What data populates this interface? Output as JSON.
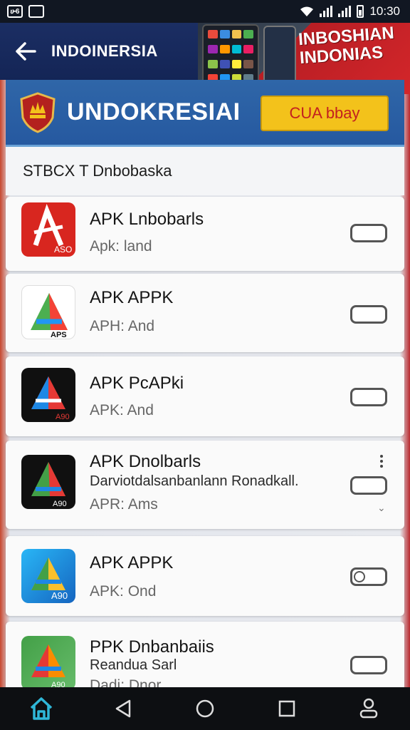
{
  "status_bar": {
    "time": "10:30",
    "left_icon_text": "ሁ6"
  },
  "header": {
    "title": "INDOINERSIA"
  },
  "banner": {
    "text": "INBOSHIAN INDONIAS"
  },
  "hero": {
    "title": "UNDOKRESIAI",
    "cta_label": "CUA bbay"
  },
  "section": {
    "title": "STBCX T Dnbobaska"
  },
  "apps": [
    {
      "name": "APK Lnbobarls",
      "desc": "",
      "meta": "Apk: land"
    },
    {
      "name": "APK APPK",
      "desc": "",
      "meta": "APH: And"
    },
    {
      "name": "APK PcAPki",
      "desc": "",
      "meta": "APK: And"
    },
    {
      "name": "APK Dnolbarls",
      "desc": "Darviotdalsanbanlann Ronadkall.",
      "meta": "APR: Ams"
    },
    {
      "name": "APK APPK",
      "desc": "",
      "meta": "APK: Ond"
    },
    {
      "name": "PPK Dnbanbaiis",
      "desc": "Reandua Sarl",
      "meta": "Dadi: Dnor"
    }
  ],
  "icon_badges": [
    "ASO",
    "APS",
    "A90",
    "A90",
    "A90",
    "A90"
  ],
  "colors": {
    "header_bg": "#1b2e63",
    "hero_bg": "#2f66a8",
    "cta_bg": "#f3c21b",
    "cta_text": "#c3201f",
    "nav_home_active": "#2fb7d8"
  }
}
